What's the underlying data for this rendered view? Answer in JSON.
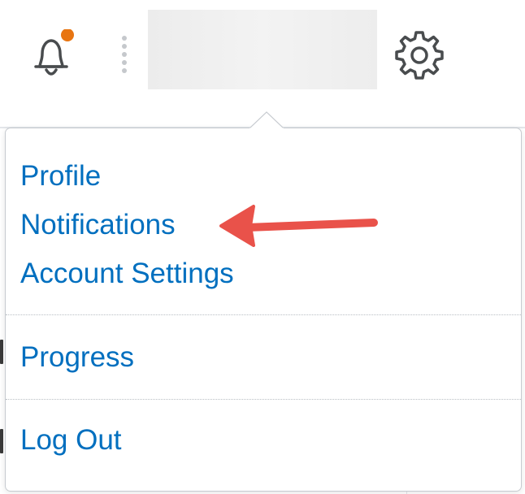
{
  "header": {
    "notification_badge_color": "#e87511",
    "icon_color": "#494c4e",
    "icons": [
      "bell-icon",
      "vertical-dots-icon",
      "gear-icon"
    ]
  },
  "user_menu": {
    "link_color": "#006fbf",
    "items": [
      {
        "label": "Profile"
      },
      {
        "label": "Notifications"
      },
      {
        "label": "Account Settings"
      },
      {
        "label": "Progress"
      },
      {
        "label": "Log Out"
      }
    ]
  },
  "annotation": {
    "arrow_color": "#e9524a",
    "points_to": "Notifications"
  }
}
